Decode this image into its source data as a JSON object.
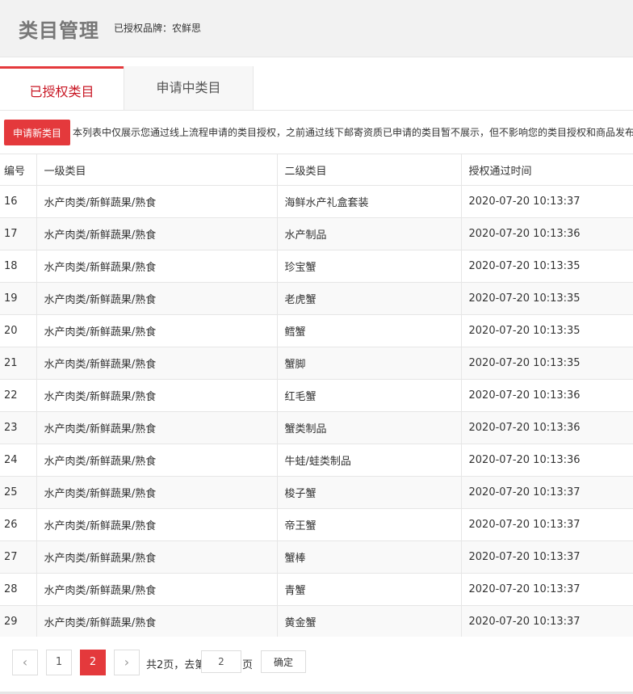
{
  "header": {
    "title": "类目管理",
    "brand_label": "已授权品牌：农鲜思"
  },
  "tabs": [
    {
      "label": "已授权类目",
      "active": true
    },
    {
      "label": "申请中类目",
      "active": false
    }
  ],
  "toolbar": {
    "apply_label": "申请新类目",
    "notice": "本列表中仅展示您通过线上流程申请的类目授权，之前通过线下邮寄资质已申请的类目暂不展示，但不影响您的类目授权和商品发布"
  },
  "table": {
    "columns": [
      "编号",
      "一级类目",
      "二级类目",
      "授权通过时间"
    ],
    "rows": [
      [
        "16",
        "水产肉类/新鲜蔬果/熟食",
        "海鲜水产礼盒套装",
        "2020-07-20 10:13:37"
      ],
      [
        "17",
        "水产肉类/新鲜蔬果/熟食",
        "水产制品",
        "2020-07-20 10:13:36"
      ],
      [
        "18",
        "水产肉类/新鲜蔬果/熟食",
        "珍宝蟹",
        "2020-07-20 10:13:35"
      ],
      [
        "19",
        "水产肉类/新鲜蔬果/熟食",
        "老虎蟹",
        "2020-07-20 10:13:35"
      ],
      [
        "20",
        "水产肉类/新鲜蔬果/熟食",
        "鳕蟹",
        "2020-07-20 10:13:35"
      ],
      [
        "21",
        "水产肉类/新鲜蔬果/熟食",
        "蟹脚",
        "2020-07-20 10:13:35"
      ],
      [
        "22",
        "水产肉类/新鲜蔬果/熟食",
        "红毛蟹",
        "2020-07-20 10:13:36"
      ],
      [
        "23",
        "水产肉类/新鲜蔬果/熟食",
        "蟹类制品",
        "2020-07-20 10:13:36"
      ],
      [
        "24",
        "水产肉类/新鲜蔬果/熟食",
        "牛蛙/蛙类制品",
        "2020-07-20 10:13:36"
      ],
      [
        "25",
        "水产肉类/新鲜蔬果/熟食",
        "梭子蟹",
        "2020-07-20 10:13:37"
      ],
      [
        "26",
        "水产肉类/新鲜蔬果/熟食",
        "帝王蟹",
        "2020-07-20 10:13:37"
      ],
      [
        "27",
        "水产肉类/新鲜蔬果/熟食",
        "蟹棒",
        "2020-07-20 10:13:37"
      ],
      [
        "28",
        "水产肉类/新鲜蔬果/熟食",
        "青蟹",
        "2020-07-20 10:13:37"
      ],
      [
        "29",
        "水产肉类/新鲜蔬果/熟食",
        "黄金蟹",
        "2020-07-20 10:13:37"
      ]
    ]
  },
  "pagination": {
    "prev_icon": "chevron-left-icon",
    "next_icon": "chevron-right-icon",
    "pages": [
      "1",
      "2"
    ],
    "current": "2",
    "total_text": "共2页，去第",
    "goto_value": "2",
    "page_suffix": "页",
    "confirm_label": "确定"
  },
  "colors": {
    "accent": "#e4393c",
    "active_tab_text": "#c81623"
  }
}
